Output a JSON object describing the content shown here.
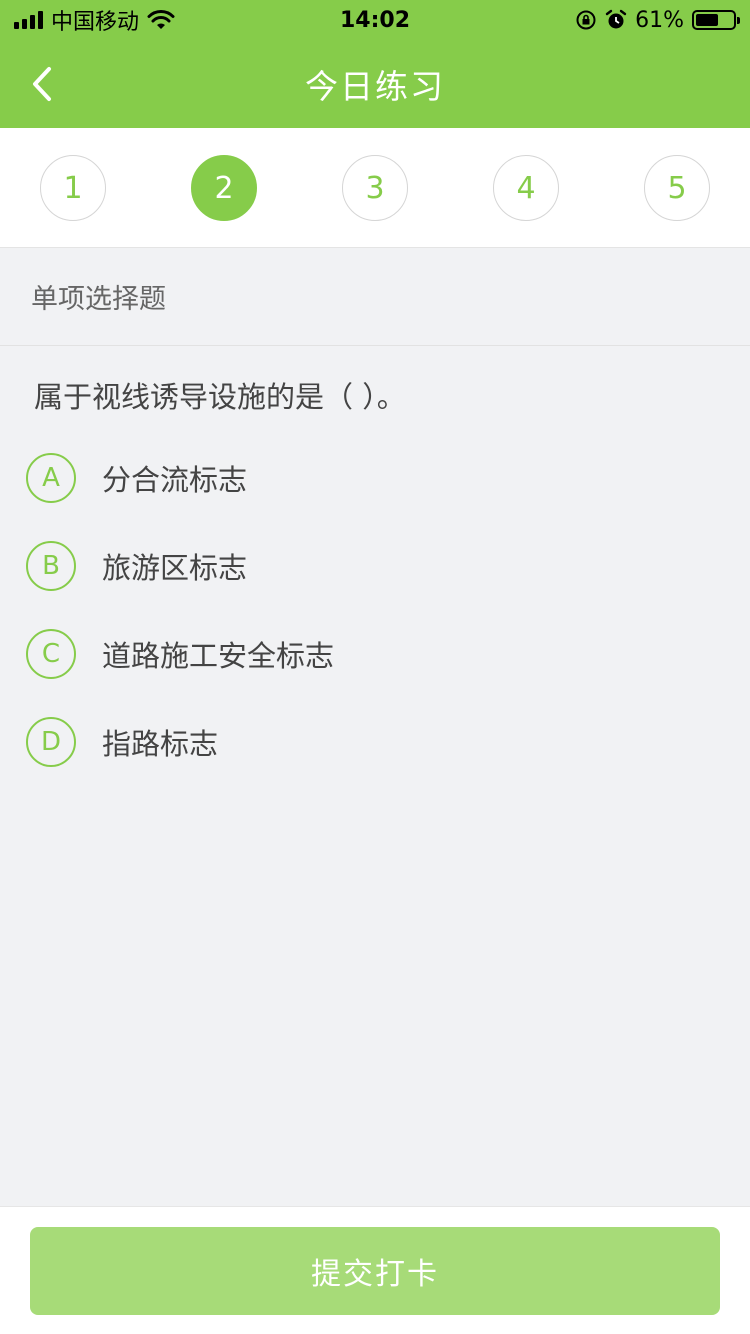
{
  "status_bar": {
    "carrier": "中国移动",
    "time": "14:02",
    "battery": "61%",
    "battery_level": 0.61,
    "icons": [
      "signal-icon",
      "wifi-icon",
      "rotation-lock-icon",
      "alarm-icon",
      "battery-icon"
    ]
  },
  "nav": {
    "title": "今日练习",
    "back_icon": "chevron-left-icon"
  },
  "steps": {
    "items": [
      "1",
      "2",
      "3",
      "4",
      "5"
    ],
    "active_index": 1
  },
  "question": {
    "type": "单项选择题",
    "text": "属于视线诱导设施的是（    ）。",
    "options": [
      {
        "letter": "A",
        "text": "分合流标志"
      },
      {
        "letter": "B",
        "text": "旅游区标志"
      },
      {
        "letter": "C",
        "text": "道路施工安全标志"
      },
      {
        "letter": "D",
        "text": "指路标志"
      }
    ]
  },
  "footer": {
    "submit_label": "提交打卡"
  },
  "colors": {
    "accent": "#86cc4a",
    "submit_bg": "#a7db78",
    "background": "#f1f2f4"
  }
}
